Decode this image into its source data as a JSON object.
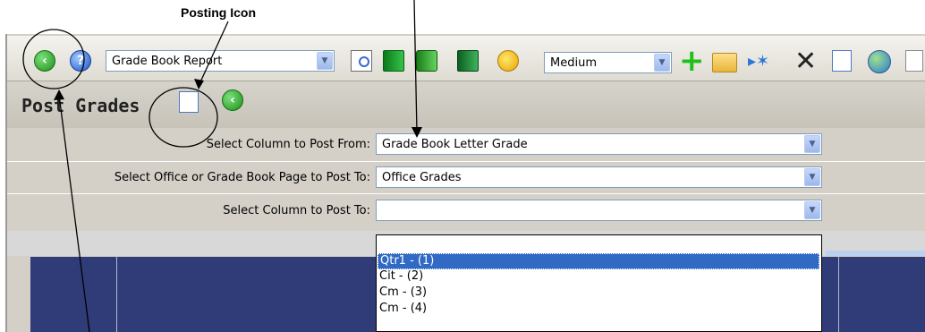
{
  "annotation": {
    "label": "Posting Icon"
  },
  "toolbar": {
    "report_select": "Grade Book Report",
    "size_select": "Medium",
    "icons": [
      "back-icon",
      "help-icon",
      "preview-icon",
      "gradebook-icon",
      "gradebook2-icon",
      "gradebook3-icon",
      "palette-icon",
      "add-icon",
      "open-folder-icon",
      "new-star-icon",
      "delete-icon",
      "copy-icon",
      "globe-icon",
      "page-icon"
    ]
  },
  "section": {
    "title": "Post Grades"
  },
  "form": {
    "rows": [
      {
        "label": "Select Column to Post From:",
        "value": "Grade Book Letter Grade"
      },
      {
        "label": "Select Office or Grade Book Page to Post To:",
        "value": "Office Grades"
      },
      {
        "label": "Select Column to Post To:",
        "value": ""
      }
    ]
  },
  "dropdown": {
    "options": [
      "",
      "Qtr1 - (1)",
      "Cit - (2)",
      "Cm - (3)",
      "Cm - (4)"
    ],
    "selected": "Qtr1 - (1)"
  },
  "colors": {
    "selection": "#316ac5",
    "grid_header": "#2f3c78",
    "toolbar_bg": "#dedbd2"
  }
}
